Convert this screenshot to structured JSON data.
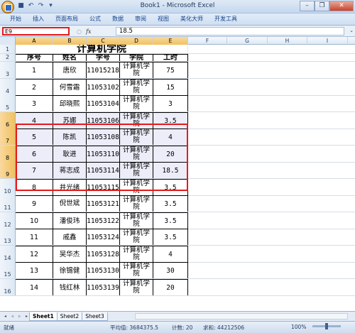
{
  "window": {
    "title": "Book1 - Microsoft Excel"
  },
  "ribbon": {
    "tabs": [
      "开始",
      "插入",
      "页面布局",
      "公式",
      "数据",
      "审阅",
      "视图",
      "美化大师",
      "开发工具"
    ]
  },
  "formula_bar": {
    "name_box": "E9",
    "fx_symbol": "fx",
    "content": "18.5"
  },
  "grid": {
    "columns": [
      "A",
      "B",
      "C",
      "D",
      "E",
      "F",
      "G",
      "H",
      "I"
    ],
    "title": "计算机学院",
    "headers": [
      "序号",
      "姓名",
      "学号",
      "学院",
      "工时"
    ],
    "rows": [
      {
        "n": "3",
        "seq": "1",
        "name": "唐欣",
        "id": "11015218",
        "dept": "计算机学院",
        "hours": "75"
      },
      {
        "n": "4",
        "seq": "2",
        "name": "何雪霜",
        "id": "11053102",
        "dept": "计算机学院",
        "hours": "15"
      },
      {
        "n": "5",
        "seq": "3",
        "name": "邱晓熙",
        "id": "11053104",
        "dept": "计算机学院",
        "hours": "3"
      },
      {
        "n": "6",
        "seq": "4",
        "name": "苏娜",
        "id": "11053106",
        "dept": "计算机学院",
        "hours": "3.5"
      },
      {
        "n": "7",
        "seq": "5",
        "name": "陈凯",
        "id": "11053108",
        "dept": "计算机学院",
        "hours": "4"
      },
      {
        "n": "8",
        "seq": "6",
        "name": "耿进",
        "id": "11053110",
        "dept": "计算机学院",
        "hours": "20"
      },
      {
        "n": "9",
        "seq": "7",
        "name": "蒋志成",
        "id": "11053114",
        "dept": "计算机学院",
        "hours": "18.5"
      },
      {
        "n": "10",
        "seq": "8",
        "name": "井光绪",
        "id": "11053115",
        "dept": "计算机学院",
        "hours": "3.5"
      },
      {
        "n": "11",
        "seq": "9",
        "name": "倪世斌",
        "id": "11053121",
        "dept": "计算机学院",
        "hours": "3.5"
      },
      {
        "n": "12",
        "seq": "10",
        "name": "潘俊玮",
        "id": "11053122",
        "dept": "计算机学院",
        "hours": "3.5"
      },
      {
        "n": "13",
        "seq": "11",
        "name": "戚鑫",
        "id": "11053124",
        "dept": "计算机学院",
        "hours": "3.5"
      },
      {
        "n": "14",
        "seq": "12",
        "name": "吴华杰",
        "id": "11053128",
        "dept": "计算机学院",
        "hours": "4"
      },
      {
        "n": "15",
        "seq": "13",
        "name": "徐锡健",
        "id": "11053130",
        "dept": "计算机学院",
        "hours": "30"
      },
      {
        "n": "16",
        "seq": "14",
        "name": "钱红林",
        "id": "11053139",
        "dept": "计算机学院",
        "hours": "20"
      }
    ]
  },
  "sheets": [
    "Sheet1",
    "Sheet2",
    "Sheet3"
  ],
  "status": {
    "mode": "就绪",
    "average": "平均值: 3684375.5",
    "count": "计数: 20",
    "sum": "求和: 44212506",
    "zoom": "100%"
  },
  "colors": {
    "selection_border": "#e31b1b",
    "selected_fill": "#ecedf8",
    "header_highlight": "#f1c15f"
  }
}
